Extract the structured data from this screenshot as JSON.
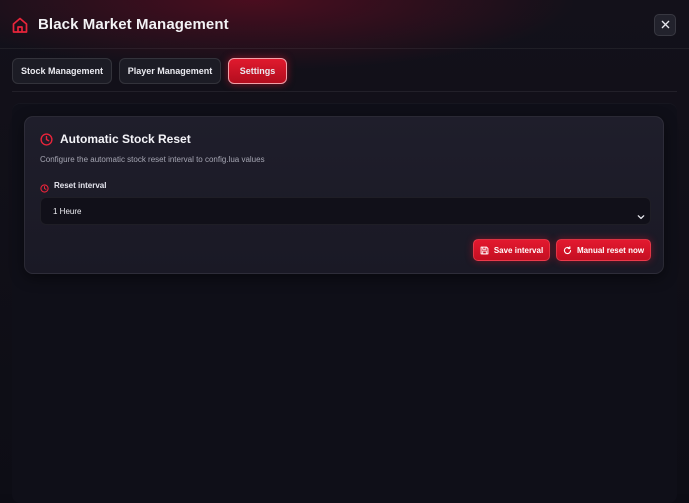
{
  "header": {
    "title": "Black Market Management",
    "home_icon": "home-icon",
    "close_icon": "close-icon"
  },
  "tabs": [
    {
      "label": "Stock Management",
      "active": false
    },
    {
      "label": "Player Management",
      "active": false
    },
    {
      "label": "Settings",
      "active": true
    }
  ],
  "settings": {
    "card_title": "Automatic Stock Reset",
    "card_icon": "clock-icon",
    "description": "Configure the automatic stock reset interval to config.lua values",
    "field_label": "Reset interval",
    "field_icon": "clock-icon",
    "interval_selected": "1 Heure",
    "save_button": "Save interval",
    "save_icon": "floppy-disk-icon",
    "reset_button": "Manual reset now",
    "reset_icon": "refresh-icon"
  },
  "colors": {
    "accent": "#e3192f",
    "background": "#0c0c14",
    "card": "#1f1e2b"
  }
}
